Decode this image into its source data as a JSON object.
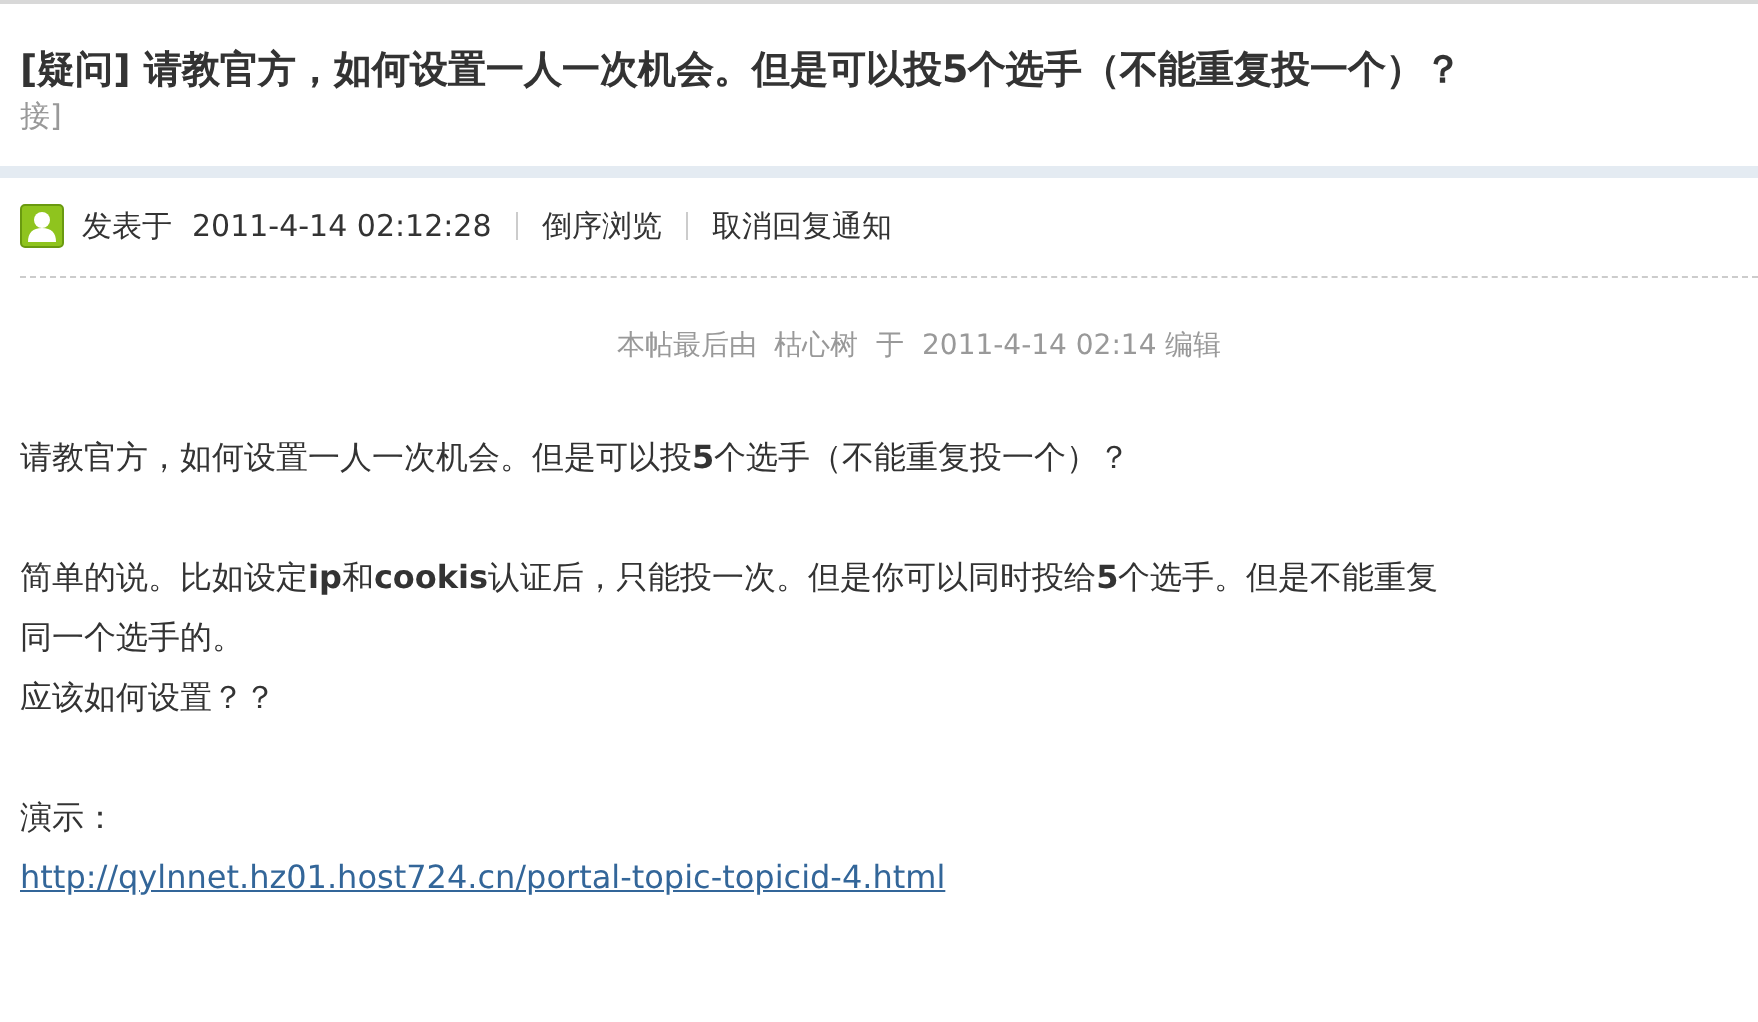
{
  "thread": {
    "title": "[疑问] 请教官方，如何设置一人一次机会。但是可以投5个选手（不能重复投一个）？",
    "title_continuation": "接]"
  },
  "post": {
    "posted_label": "发表于",
    "posted_time": "2011-4-14 02:12:28",
    "links": [
      "倒序浏览",
      "取消回复通知"
    ],
    "edit_note": "本帖最后由  枯心树  于  2011-4-14 02:14 编辑",
    "lines": [
      {
        "kind": "text",
        "text": "请教官方，如何设置一人一次机会。但是可以投**5**个选手（不能重复投一个）？"
      },
      {
        "kind": "gap"
      },
      {
        "kind": "text",
        "text": "简单的说。比如设定**ip**和**cookis**认证后，只能投一次。但是你可以同时投给**5**个选手。但是不能重复"
      },
      {
        "kind": "text",
        "text": "同一个选手的。"
      },
      {
        "kind": "text",
        "text": "应该如何设置？？"
      },
      {
        "kind": "gap"
      },
      {
        "kind": "text",
        "text": "演示："
      },
      {
        "kind": "link",
        "text": "http://qylnnet.hz01.host724.cn/portal-topic-topicid-4.html"
      }
    ]
  }
}
